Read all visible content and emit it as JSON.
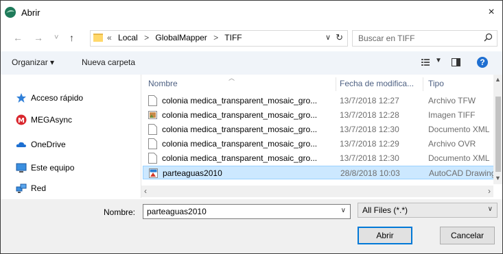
{
  "window": {
    "title": "Abrir",
    "close": "×"
  },
  "nav": {
    "back": "←",
    "forward": "→",
    "recent": "˅",
    "up": "↑",
    "path_prefix": "«",
    "crumbs": [
      "Local",
      "GlobalMapper",
      "TIFF"
    ],
    "separators": [
      ">",
      ">"
    ],
    "refresh": "↻",
    "search_placeholder": "Buscar en TIFF"
  },
  "toolbar": {
    "organize": "Organizar ▾",
    "new_folder": "Nueva carpeta",
    "help": "?"
  },
  "sidebar": {
    "items": [
      {
        "label": "Acceso rápido",
        "icon": "star-icon"
      },
      {
        "label": "MEGAsync",
        "icon": "mega-icon"
      },
      {
        "label": "OneDrive",
        "icon": "cloud-icon"
      },
      {
        "label": "Este equipo",
        "icon": "monitor-icon"
      },
      {
        "label": "Red",
        "icon": "network-icon"
      }
    ]
  },
  "files": {
    "columns": {
      "name": "Nombre",
      "date": "Fecha de modifica...",
      "type": "Tipo"
    },
    "rows": [
      {
        "name": "colonia medica_transparent_mosaic_gro...",
        "date": "13/7/2018 12:27",
        "type": "Archivo TFW",
        "icon": "document-icon"
      },
      {
        "name": "colonia medica_transparent_mosaic_gro...",
        "date": "13/7/2018 12:28",
        "type": "Imagen TIFF",
        "icon": "image-icon"
      },
      {
        "name": "colonia medica_transparent_mosaic_gro...",
        "date": "13/7/2018 12:30",
        "type": "Documento XML",
        "icon": "document-icon"
      },
      {
        "name": "colonia medica_transparent_mosaic_gro...",
        "date": "13/7/2018 12:29",
        "type": "Archivo OVR",
        "icon": "document-icon"
      },
      {
        "name": "colonia medica_transparent_mosaic_gro...",
        "date": "13/7/2018 12:30",
        "type": "Documento XML",
        "icon": "document-icon"
      },
      {
        "name": "parteaguas2010",
        "date": "28/8/2018 10:03",
        "type": "AutoCAD Drawing",
        "icon": "autocad-icon",
        "selected": true
      }
    ]
  },
  "footer": {
    "filename_label": "Nombre:",
    "filename_value": "parteaguas2010",
    "filetype": "All Files (*.*)",
    "open": "Abrir",
    "cancel": "Cancelar"
  },
  "colors": {
    "selection": "#cce8ff",
    "selection_border": "#99d1ff",
    "accent": "#0078d7",
    "toolbar_bg": "#f0f4f9"
  }
}
